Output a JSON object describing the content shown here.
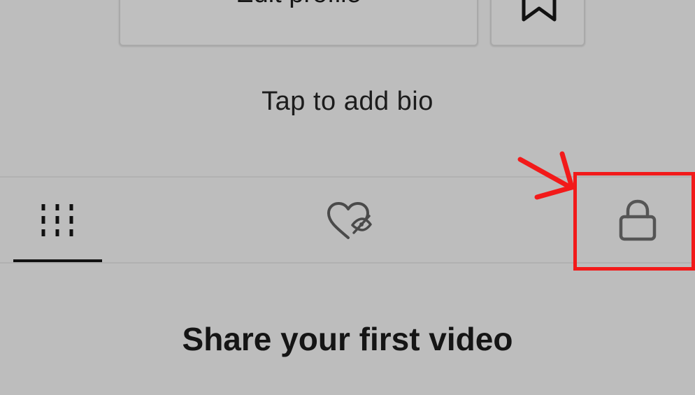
{
  "profile": {
    "edit_button_label": "Edit profile",
    "bio_placeholder": "Tap to add bio"
  },
  "tabs": [
    {
      "id": "videos",
      "icon": "grid-icon",
      "active": true
    },
    {
      "id": "liked",
      "icon": "hidden-heart-icon",
      "active": false
    },
    {
      "id": "private",
      "icon": "lock-icon",
      "active": false
    }
  ],
  "empty_state": {
    "title": "Share your first video"
  },
  "annotation": {
    "highlight_color": "#f21a1a"
  }
}
